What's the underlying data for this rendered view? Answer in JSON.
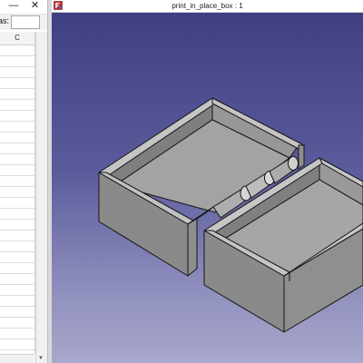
{
  "spreadsheet_window": {
    "minimize_glyph": "—",
    "close_glyph": "✕",
    "alias_label": "as:",
    "alias_value": "",
    "column_header": "C"
  },
  "view_window": {
    "title": "print_in_place_box : 1",
    "app_icon": "freecad-icon"
  },
  "colors": {
    "viewport_top": "#3f3f82",
    "viewport_bottom": "#a8a8cc",
    "model_face": "#8e8e8e",
    "model_edge": "#151515"
  }
}
